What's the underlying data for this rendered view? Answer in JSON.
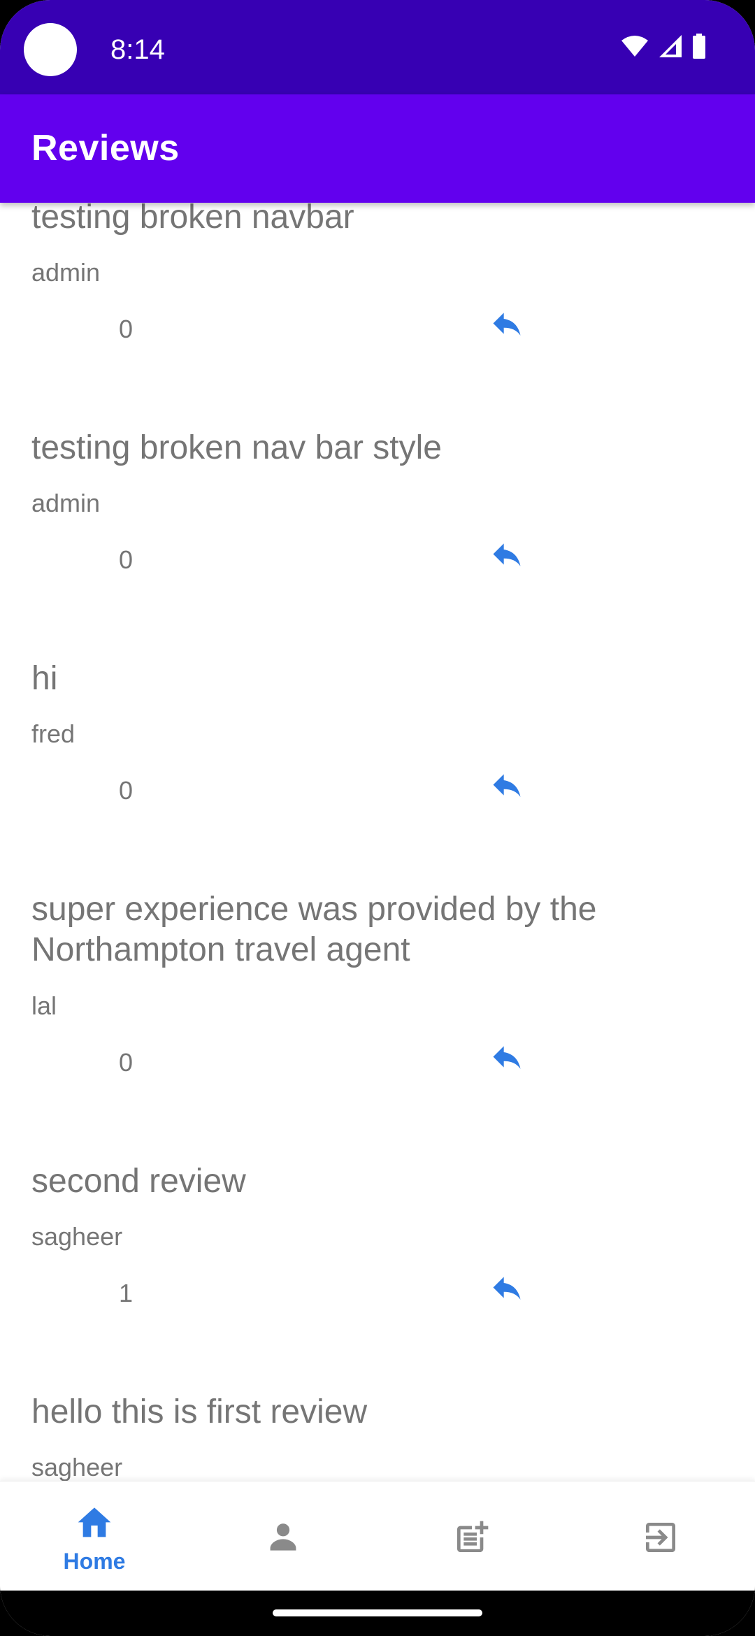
{
  "status_bar": {
    "time": "8:14",
    "icons": [
      "wifi-icon",
      "cell-signal-icon",
      "battery-icon"
    ]
  },
  "app_bar": {
    "title": "Reviews"
  },
  "reviews": [
    {
      "title": "testing broken navbar",
      "author": "admin",
      "count": "0"
    },
    {
      "title": "testing broken nav bar style",
      "author": "admin",
      "count": "0"
    },
    {
      "title": "hi",
      "author": "fred",
      "count": "0"
    },
    {
      "title": "super experience was provided by the Northampton travel agent",
      "author": "lal",
      "count": "0"
    },
    {
      "title": "second review",
      "author": "sagheer",
      "count": "1"
    },
    {
      "title": "hello this is first review",
      "author": "sagheer",
      "count": ""
    }
  ],
  "bottom_nav": {
    "items": [
      {
        "label": "Home",
        "icon": "home-icon",
        "active": true
      },
      {
        "label": "",
        "icon": "person-icon",
        "active": false
      },
      {
        "label": "",
        "icon": "post-add-icon",
        "active": false
      },
      {
        "label": "",
        "icon": "logout-icon",
        "active": false
      }
    ]
  },
  "colors": {
    "status_bar": "#3700B3",
    "app_bar": "#6200EE",
    "accent_blue": "#2F7BE3",
    "text_gray": "#757575",
    "icon_gray": "#8A8A8A"
  }
}
